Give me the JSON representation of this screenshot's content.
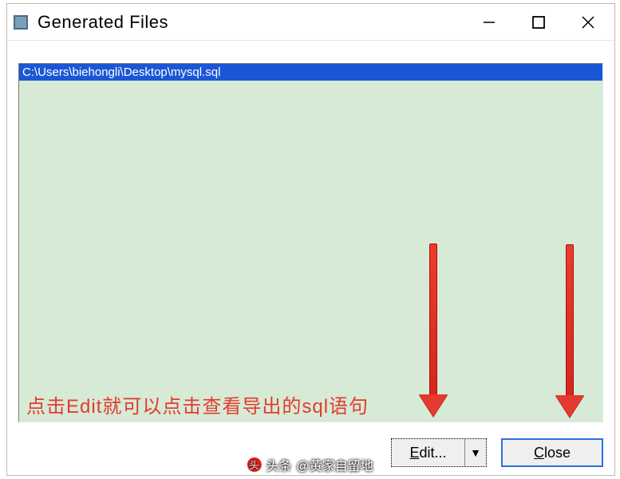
{
  "window": {
    "title": "Generated Files"
  },
  "list": {
    "items": [
      "C:\\Users\\biehongli\\Desktop\\mysql.sql"
    ]
  },
  "annotation": "点击Edit就可以点击查看导出的sql语句",
  "buttons": {
    "edit_label_u": "E",
    "edit_label_rest": "dit...",
    "dropdown_glyph": "▼",
    "close_label_u": "C",
    "close_label_rest": "lose"
  },
  "watermark": {
    "prefix": "头条",
    "handle": "@黄家自留地"
  }
}
